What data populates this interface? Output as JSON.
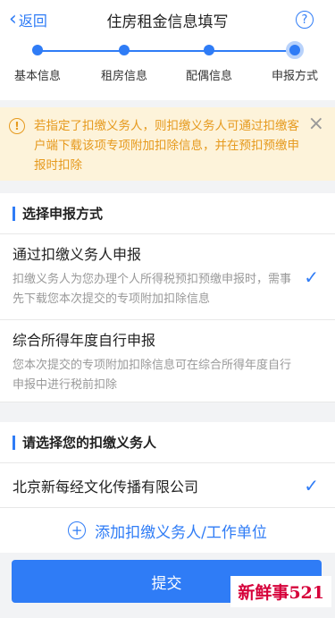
{
  "nav": {
    "back_label": "返回",
    "title": "住房租金信息填写",
    "help_glyph": "?"
  },
  "steps": [
    {
      "label": "基本信息",
      "state": "done"
    },
    {
      "label": "租房信息",
      "state": "done"
    },
    {
      "label": "配偶信息",
      "state": "done"
    },
    {
      "label": "申报方式",
      "state": "current"
    }
  ],
  "notice": {
    "text": "若指定了扣缴义务人，则扣缴义务人可通过扣缴客户端下载该项专项附加扣除信息，并在预扣预缴申报时扣除",
    "warn_glyph": "!",
    "close_glyph": "×"
  },
  "method_section": {
    "heading": "选择申报方式",
    "options": [
      {
        "title": "通过扣缴义务人申报",
        "desc": "扣缴义务人为您办理个人所得税预扣预缴申报时，需事先下载您本次提交的专项附加扣除信息",
        "selected": true
      },
      {
        "title": "综合所得年度自行申报",
        "desc": "您本次提交的专项附加扣除信息可在综合所得年度自行申报中进行税前扣除",
        "selected": false
      }
    ]
  },
  "employer_section": {
    "heading": "请选择您的扣缴义务人",
    "employer_name": "北京新每经文化传播有限公司",
    "add_label": "添加扣缴义务人/工作单位"
  },
  "submit_label": "提交",
  "watermark": {
    "text": "新鲜事",
    "number": "521"
  },
  "colors": {
    "accent": "#2f7cf6",
    "warning": "#e69a1e",
    "notice_bg": "#fdf3da"
  },
  "icons": {
    "check": "✓",
    "plus": "+"
  }
}
